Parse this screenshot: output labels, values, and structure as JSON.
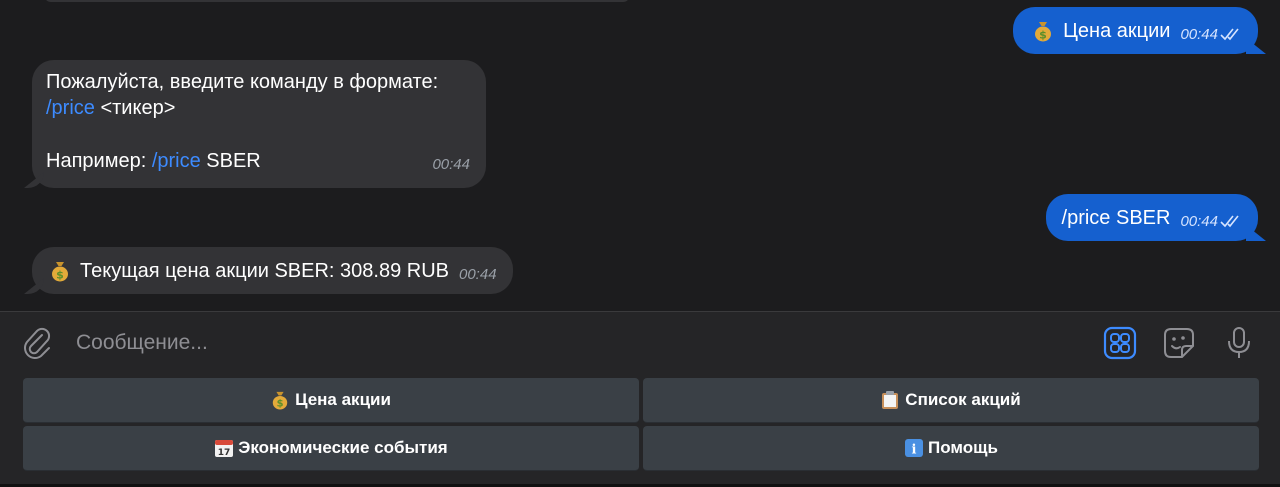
{
  "messages": {
    "m1": {
      "text": "Цена акции",
      "time": "00:44",
      "icon": "money-bag-icon"
    },
    "m2": {
      "line1": "Пожалуйста, введите команду в формате:",
      "line2_cmd": "/price",
      "line2_rest": " <тикер>",
      "line3_prefix": "Например: ",
      "line3_cmd": "/price",
      "line3_rest": " SBER",
      "time": "00:44"
    },
    "m3": {
      "text": "/price SBER",
      "time": "00:44"
    },
    "m4": {
      "text": "Текущая цена акции SBER: 308.89 RUB",
      "time": "00:44",
      "icon": "money-bag-icon"
    }
  },
  "input": {
    "placeholder": "Сообщение..."
  },
  "keyboard": {
    "buttons": [
      {
        "label": "Цена акции",
        "icon": "money-bag-icon"
      },
      {
        "label": "Список акций",
        "icon": "clipboard-icon"
      },
      {
        "label": "Экономические события",
        "icon": "calendar-icon"
      },
      {
        "label": "Помощь",
        "icon": "info-icon"
      }
    ]
  },
  "colors": {
    "background": "#1c1c1e",
    "incoming": "#333336",
    "outgoing": "#1560cf",
    "link": "#3d8bff",
    "button": "#3a4046"
  }
}
